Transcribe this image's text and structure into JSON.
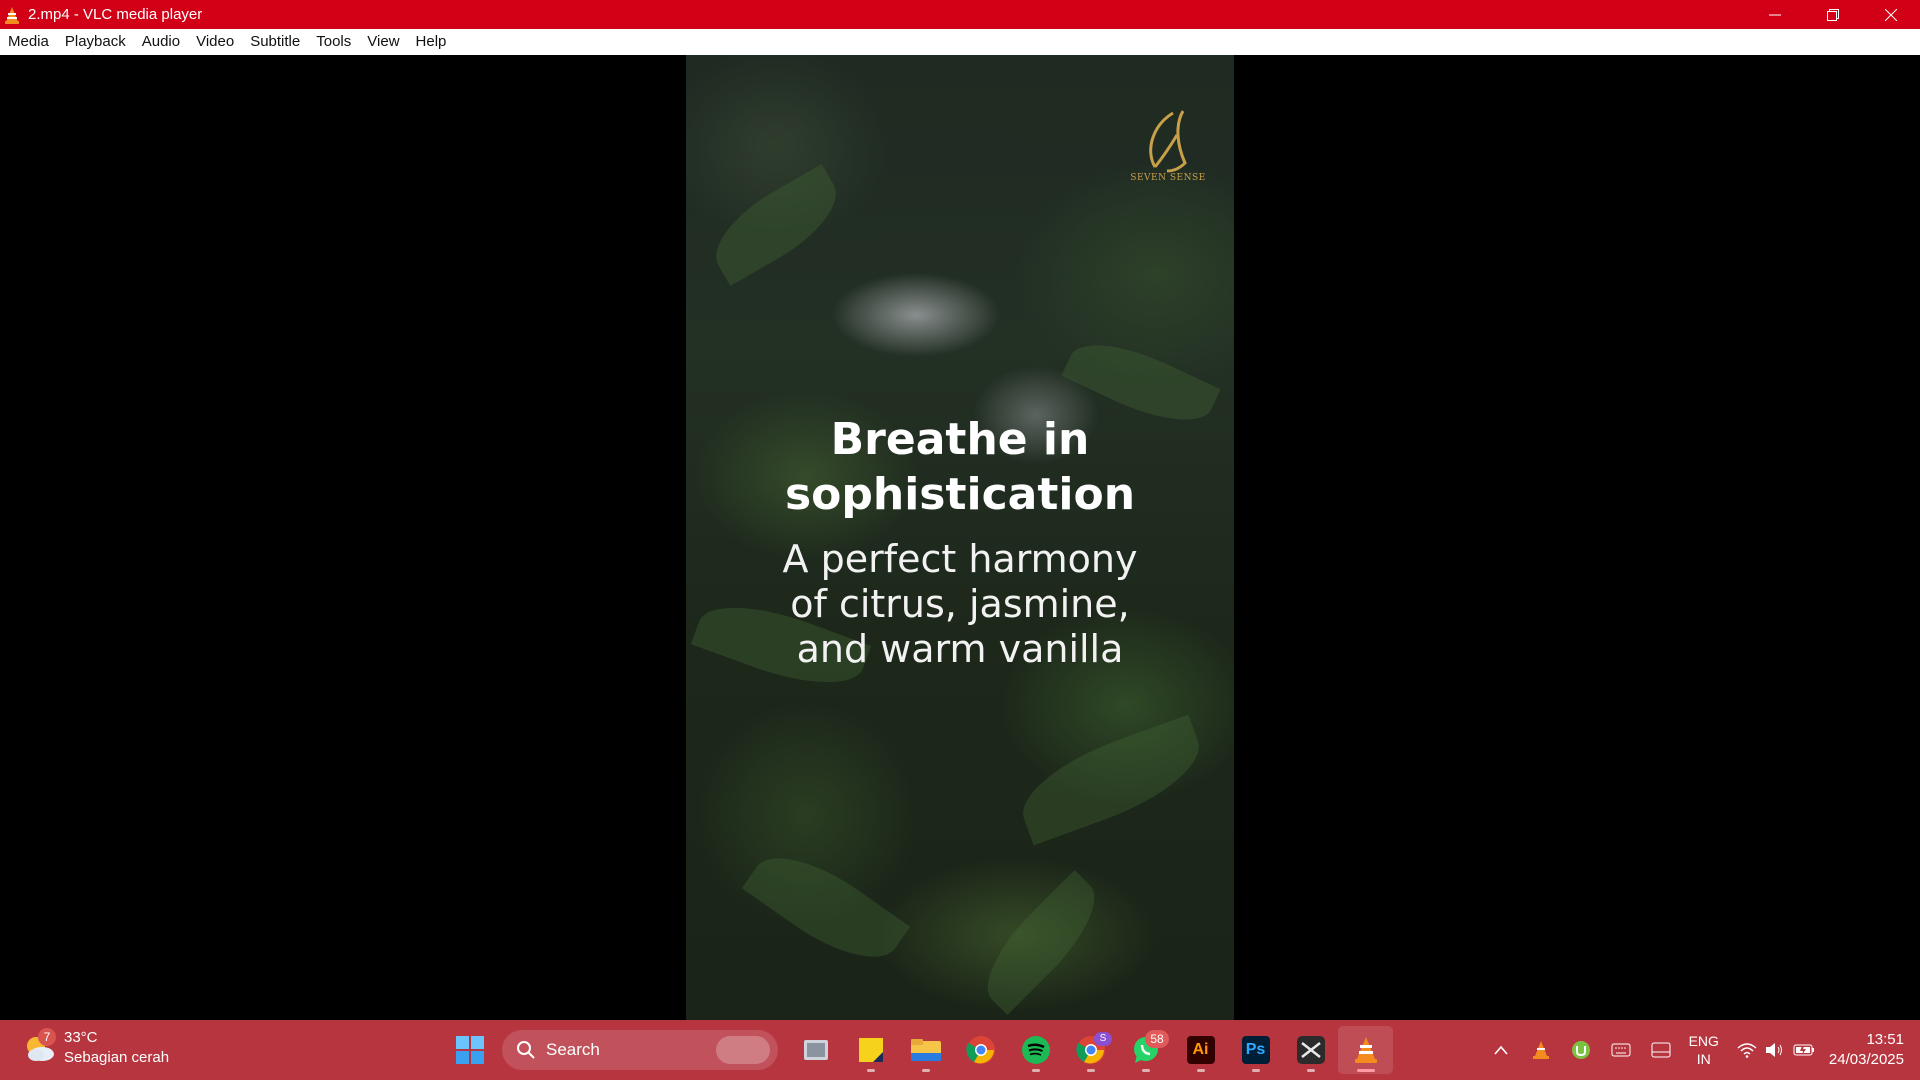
{
  "window": {
    "title": "2.mp4 - VLC media player",
    "accent_color": "#d20016"
  },
  "menu": [
    "Media",
    "Playback",
    "Audio",
    "Video",
    "Subtitle",
    "Tools",
    "View",
    "Help"
  ],
  "video": {
    "logo_text": "SEVEN SENSE",
    "headline_1": "Breathe in",
    "headline_2": "sophistication",
    "subline_1": "A perfect harmony",
    "subline_2": "of citrus, jasmine,",
    "subline_3": "and warm vanilla"
  },
  "taskbar": {
    "color": "#b7353f",
    "weather": {
      "badge": "7",
      "temp": "33°C",
      "desc": "Sebagian cerah"
    },
    "search_label": "Search",
    "apps": [
      {
        "name": "task-view-icon"
      },
      {
        "name": "sticky-notes-icon"
      },
      {
        "name": "file-explorer-icon"
      },
      {
        "name": "chrome-icon"
      },
      {
        "name": "spotify-icon"
      },
      {
        "name": "chrome-profile-icon",
        "badge": "S"
      },
      {
        "name": "whatsapp-icon",
        "badge": "58"
      },
      {
        "name": "illustrator-icon",
        "label": "Ai"
      },
      {
        "name": "photoshop-icon",
        "label": "Ps"
      },
      {
        "name": "capcut-icon"
      },
      {
        "name": "vlc-icon"
      }
    ],
    "language": {
      "line1": "ENG",
      "line2": "IN"
    },
    "clock": {
      "time": "13:51",
      "date": "24/03/2025"
    }
  }
}
